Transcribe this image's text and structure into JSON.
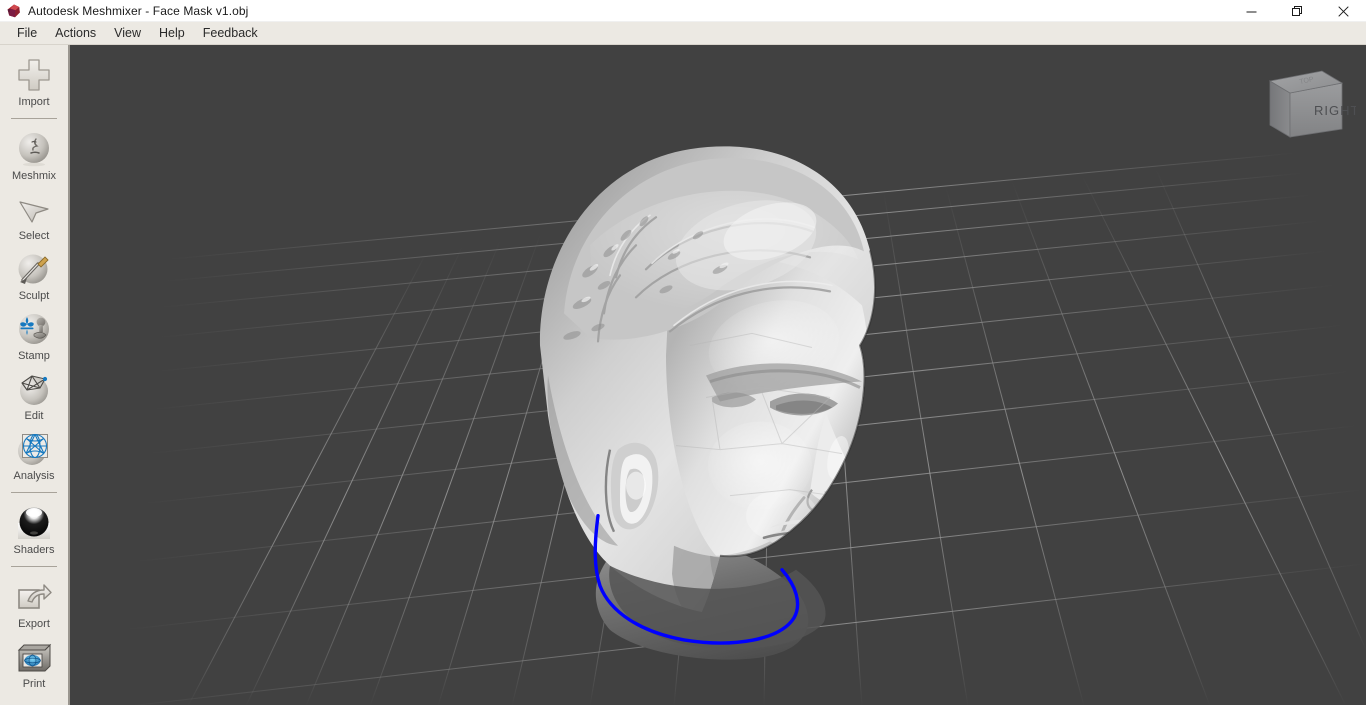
{
  "window": {
    "title": "Autodesk Meshmixer - Face Mask v1.obj",
    "logo_icon": "autodesk-polyhedron-icon",
    "controls": {
      "minimize": "—",
      "maximize": "❐",
      "close": "✕"
    }
  },
  "menubar": {
    "items": [
      {
        "label": "File"
      },
      {
        "label": "Actions"
      },
      {
        "label": "View"
      },
      {
        "label": "Help"
      },
      {
        "label": "Feedback"
      }
    ]
  },
  "sidebar": {
    "items": [
      {
        "label": "Import",
        "icon": "plus-import-icon"
      },
      {
        "separator_after": true
      },
      {
        "label": "Meshmix",
        "icon": "face-sphere-icon"
      },
      {
        "label": "Select",
        "icon": "arrow-cursor-icon"
      },
      {
        "label": "Sculpt",
        "icon": "brush-sphere-icon"
      },
      {
        "label": "Stamp",
        "icon": "stamp-fleur-icon"
      },
      {
        "label": "Edit",
        "icon": "wireframe-sphere-icon"
      },
      {
        "label": "Analysis",
        "icon": "analysis-mesh-icon"
      },
      {
        "separator_after": true
      },
      {
        "label": "Shaders",
        "icon": "glossy-sphere-icon"
      },
      {
        "separator_after": true
      },
      {
        "label": "Export",
        "icon": "export-arrow-icon"
      },
      {
        "label": "Print",
        "icon": "printer-3d-icon"
      }
    ]
  },
  "viewport": {
    "background_color": "#414141",
    "grid_color": "#8d8d8d",
    "model": {
      "name": "face-mask-head-mesh",
      "material_color": "#d9d9d9",
      "shading": "gray-matte"
    },
    "selection_boundary": {
      "name": "neck-boundary-curve",
      "color": "#0000ff"
    },
    "viewcube": {
      "front_face_label": "RIGHT",
      "top_face_label": "TOP",
      "face_color": "#8e8f91"
    }
  }
}
